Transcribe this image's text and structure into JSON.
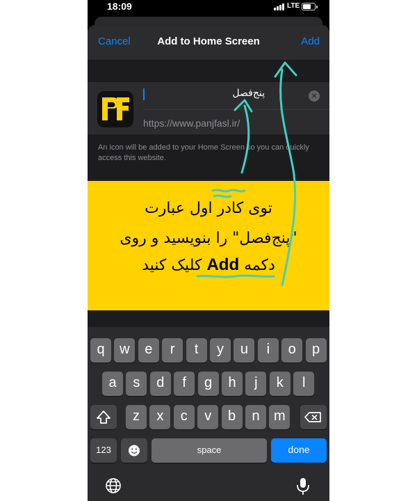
{
  "status_bar": {
    "time": "18:09",
    "network": "LTE"
  },
  "nav": {
    "cancel_label": "Cancel",
    "title": "Add to Home Screen",
    "add_label": "Add"
  },
  "form": {
    "name_value": "پنج‌فصل",
    "url": "https://www.panjfasl.ir/",
    "hint": "An icon will be added to your Home Screen so you can quickly access this website."
  },
  "annotation": {
    "line1": "توی کادر اول عبارت",
    "line2": "\"پنج‌فصل\" را بنویسید و روی",
    "line3_pre": "دکمه",
    "line3_add": "Add",
    "line3_post": "کلیک کنید",
    "colors": {
      "background": "#ffd200",
      "ink": "#3fd1c3"
    }
  },
  "keyboard": {
    "row1": [
      "q",
      "w",
      "e",
      "r",
      "t",
      "y",
      "u",
      "i",
      "o",
      "p"
    ],
    "row2": [
      "a",
      "s",
      "d",
      "f",
      "g",
      "h",
      "j",
      "k",
      "l"
    ],
    "row3": [
      "z",
      "x",
      "c",
      "v",
      "b",
      "n",
      "m"
    ],
    "numbers_label": "123",
    "space_label": "space",
    "done_label": "done",
    "icons": {
      "shift": "shift-icon",
      "delete": "delete-icon",
      "emoji": "emoji-icon",
      "globe": "globe-icon",
      "mic": "mic-icon"
    }
  },
  "colors": {
    "accent": "#0a84ff",
    "sheet": "#1c1c1e",
    "cell": "#2c2c2e"
  }
}
